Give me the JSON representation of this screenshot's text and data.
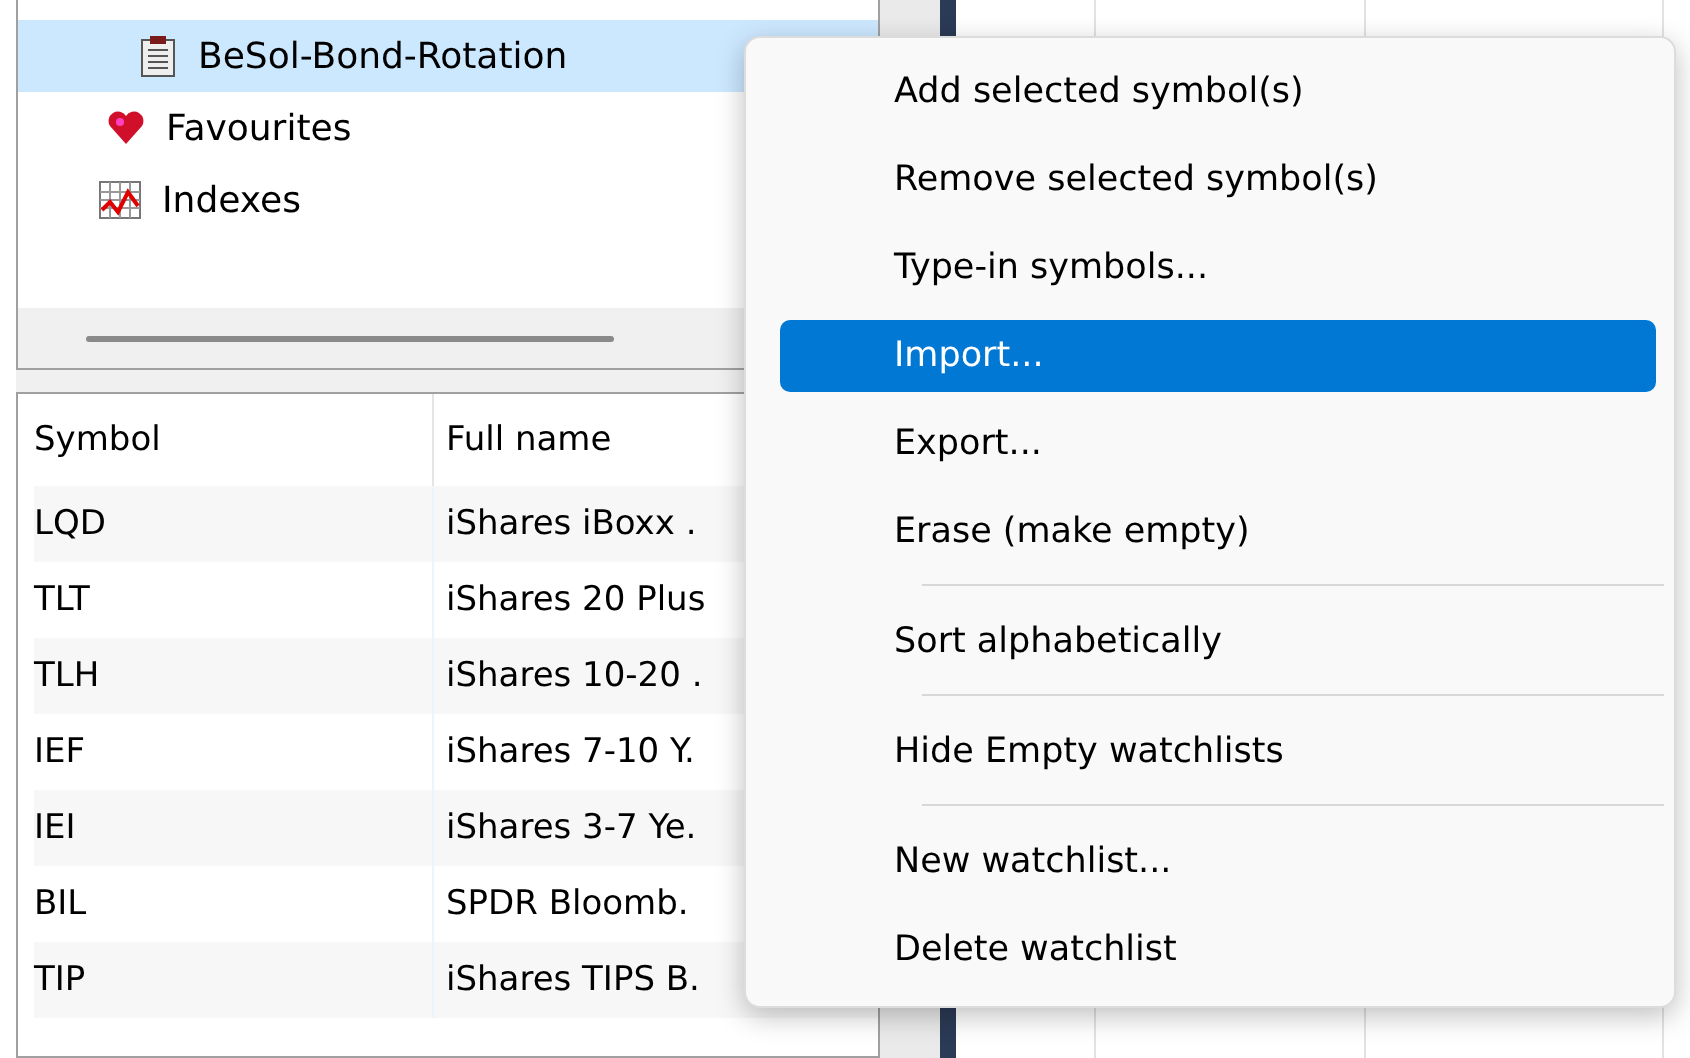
{
  "tree": {
    "items": [
      {
        "label": "BeSol-Bond-Rotation",
        "kind": "watchlist",
        "selected": true
      },
      {
        "label": "Favourites",
        "kind": "favourites",
        "selected": false
      },
      {
        "label": "Indexes",
        "kind": "indexes",
        "selected": false
      }
    ]
  },
  "table": {
    "columns": [
      "Symbol",
      "Full name"
    ],
    "rows": [
      [
        "LQD",
        "iShares iBoxx ."
      ],
      [
        "TLT",
        "iShares 20 Plus"
      ],
      [
        "TLH",
        "iShares 10-20 ."
      ],
      [
        "IEF",
        "iShares 7-10 Y."
      ],
      [
        "IEI",
        "iShares 3-7 Ye."
      ],
      [
        "BIL",
        "SPDR Bloomb."
      ],
      [
        "TIP",
        "iShares TIPS B."
      ]
    ]
  },
  "context_menu": {
    "items": [
      {
        "kind": "item",
        "label": "Add selected symbol(s)",
        "selected": false
      },
      {
        "kind": "item",
        "label": "Remove selected symbol(s)",
        "selected": false
      },
      {
        "kind": "item",
        "label": "Type-in symbols...",
        "selected": false
      },
      {
        "kind": "item",
        "label": "Import...",
        "selected": true
      },
      {
        "kind": "item",
        "label": "Export...",
        "selected": false
      },
      {
        "kind": "item",
        "label": "Erase (make empty)",
        "selected": false
      },
      {
        "kind": "separator"
      },
      {
        "kind": "item",
        "label": "Sort alphabetically",
        "selected": false
      },
      {
        "kind": "separator"
      },
      {
        "kind": "item",
        "label": "Hide Empty watchlists",
        "selected": false
      },
      {
        "kind": "separator"
      },
      {
        "kind": "item",
        "label": "New watchlist...",
        "selected": false
      },
      {
        "kind": "item",
        "label": "Delete watchlist",
        "selected": false
      }
    ]
  }
}
